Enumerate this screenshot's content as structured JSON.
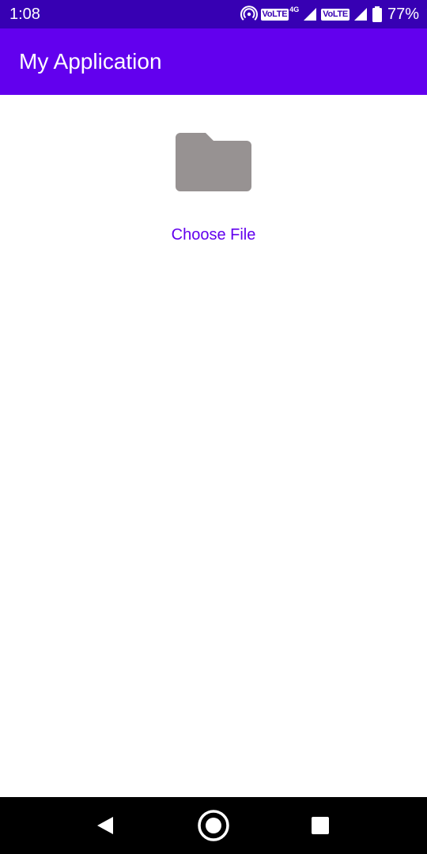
{
  "status_bar": {
    "time": "1:08",
    "volte_1": "VoLTE",
    "network_type": "4G",
    "volte_2": "VoLTE",
    "battery_percent": "77%",
    "icons": [
      "hotspot-icon",
      "volte-icon",
      "signal-icon",
      "volte-icon",
      "signal-icon",
      "battery-icon"
    ]
  },
  "app_bar": {
    "title": "My Application"
  },
  "main": {
    "icon": "folder-icon",
    "choose_file_label": "Choose File"
  },
  "nav_bar": {
    "icons": [
      "back-icon",
      "home-icon",
      "recents-icon"
    ]
  },
  "colors": {
    "status_bar": "#3700b3",
    "app_bar": "#6200ee",
    "accent_text": "#6200ee",
    "folder": "#979292",
    "nav_bar": "#000000"
  }
}
